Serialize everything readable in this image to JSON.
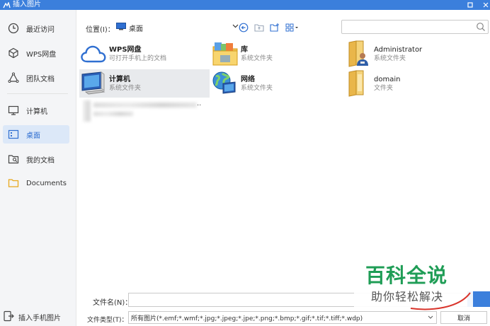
{
  "window": {
    "title": "插入图片"
  },
  "sidebar": {
    "items": [
      {
        "label": "最近访问"
      },
      {
        "label": "WPS网盘"
      },
      {
        "label": "团队文档"
      },
      {
        "label": "计算机"
      },
      {
        "label": "桌面"
      },
      {
        "label": "我的文档"
      },
      {
        "label": "Documents"
      }
    ],
    "active_index": 4,
    "mobile_label": "插入手机图片"
  },
  "toolbar": {
    "location_label": "位置(I)：",
    "location_value": "桌面",
    "search_placeholder": ""
  },
  "files": [
    {
      "name": "WPS网盘",
      "sub": "可打开手机上的文档",
      "icon": "cloud-icon"
    },
    {
      "name": "库",
      "sub": "系统文件夹",
      "icon": "library-icon"
    },
    {
      "name": "Administrator",
      "sub": "系统文件夹",
      "icon": "user-folder-icon"
    },
    {
      "name": "计算机",
      "sub": "系统文件夹",
      "icon": "computer-icon"
    },
    {
      "name": "网络",
      "sub": "系统文件夹",
      "icon": "network-icon"
    },
    {
      "name": "domain",
      "sub": "文件夹",
      "icon": "folder-icon"
    }
  ],
  "blurred_item_suffix": "..",
  "bottom": {
    "filename_label": "文件名(N)：",
    "filename_value": "",
    "filetype_label": "文件类型(T)：",
    "filetype_value": "所有图片(*.emf;*.wmf;*.jpg;*.jpeg;*.jpe;*.png;*.bmp;*.gif;*.tif;*.tiff;*.wdp)",
    "cancel_label": "取消"
  },
  "watermark": {
    "line1": "百科全说",
    "line2": "助你轻松解决"
  },
  "colors": {
    "accent": "#3b7fdc",
    "active_bg": "#dce8f8",
    "watermark_green": "#1f9d56"
  }
}
